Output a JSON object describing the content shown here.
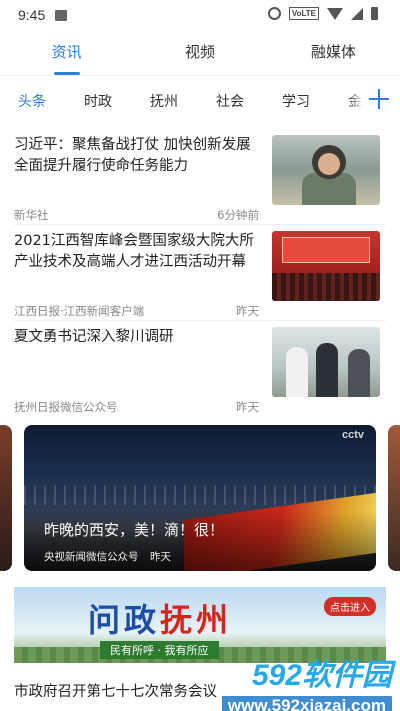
{
  "status_bar": {
    "time": "9:45",
    "network": "VoLTE"
  },
  "top_tabs": [
    {
      "label": "资讯"
    },
    {
      "label": "视频"
    },
    {
      "label": "融媒体"
    }
  ],
  "channels": [
    {
      "label": "头条"
    },
    {
      "label": "时政"
    },
    {
      "label": "抚州"
    },
    {
      "label": "社会"
    },
    {
      "label": "学习"
    },
    {
      "label": "金"
    }
  ],
  "news": [
    {
      "title": "习近平：聚焦备战打仗 加快创新发展 全面提升履行使命任务能力",
      "source": "新华社",
      "time": "6分钟前"
    },
    {
      "title": "2021江西智库峰会暨国家级大院大所产业技术及高端人才进江西活动开幕",
      "source": "江西日报·江西新闻客户端",
      "time": "昨天"
    },
    {
      "title": "夏文勇书记深入黎川调研",
      "source": "抚州日报微信公众号",
      "time": "昨天"
    }
  ],
  "video": {
    "title": "昨晚的西安，美！滴！很！",
    "source": "央视新闻微信公众号",
    "time": "昨天",
    "channel_logo": "cctv"
  },
  "banner": {
    "title_part1": "问政",
    "title_part2": "抚州",
    "slogan": "民有所呼 · 我有所应",
    "button": "点击进入"
  },
  "bottom_news": {
    "title": "市政府召开第七十七次常务会议"
  },
  "watermark": {
    "brand_num": "592",
    "brand_cn": "软件园",
    "url": "www.592xiazai.com"
  }
}
